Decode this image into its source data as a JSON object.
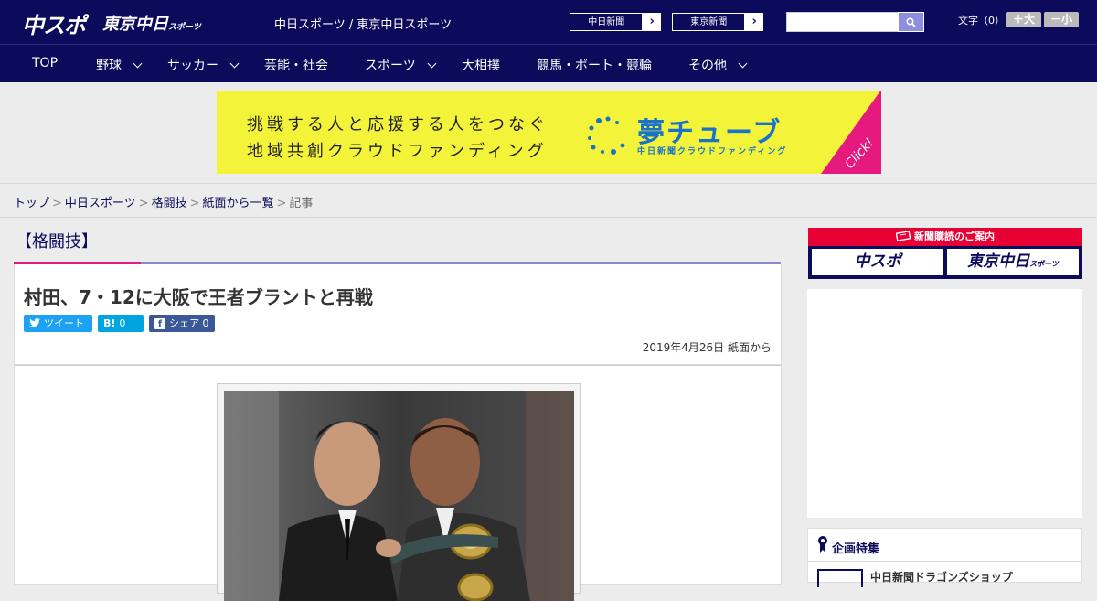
{
  "header": {
    "logo_primary": "中スポ",
    "logo_secondary": "東京中日",
    "logo_secondary_small": "スポーツ",
    "site_title": "中日スポーツ / 東京中日スポーツ",
    "links": [
      {
        "label": "中日新聞",
        "arrow": "›"
      },
      {
        "label": "東京新聞",
        "arrow": "›"
      }
    ],
    "search_placeholder": "",
    "font_size_label": "文字（0）",
    "font_bigger": "＋大",
    "font_smaller": "－小"
  },
  "nav": {
    "items": [
      {
        "label": "TOP",
        "dropdown": false
      },
      {
        "label": "野球",
        "dropdown": true
      },
      {
        "label": "サッカー",
        "dropdown": true
      },
      {
        "label": "芸能・社会",
        "dropdown": false
      },
      {
        "label": "スポーツ",
        "dropdown": true
      },
      {
        "label": "大相撲",
        "dropdown": false
      },
      {
        "label": "競馬・ボート・競輪",
        "dropdown": false
      },
      {
        "label": "その他",
        "dropdown": true
      }
    ]
  },
  "ad": {
    "line1": "挑戦する人と応援する人をつなぐ",
    "line2": "地域共創クラウドファンディング",
    "brand": "夢チューブ",
    "brand_sub": "中日新聞クラウドファンディング",
    "click": "Click!",
    "colors": {
      "bg": "#f3f33a",
      "brand": "#1a73c9",
      "corner": "#e6197f"
    }
  },
  "breadcrumb": {
    "items": [
      "トップ",
      "中日スポーツ",
      "格闘技",
      "紙面から一覧"
    ],
    "current": "記事",
    "separator": ">"
  },
  "article": {
    "category": "【格闘技】",
    "headline": "村田、7・12に大阪で王者ブラントと再戦",
    "share": {
      "tweet": "ツイート",
      "hatena_icon": "B!",
      "hatena_count": "0",
      "facebook_icon": "f",
      "facebook_label": "シェア",
      "facebook_count": "0"
    },
    "date": "2019年4月26日",
    "source": "紙面から"
  },
  "sidebar": {
    "subscription_title": "新聞購読のご案内",
    "subscription_logo1": "中スポ",
    "subscription_logo2": "東京中日",
    "subscription_logo2_small": "スポーツ",
    "feature_title": "企画特集",
    "feature_item": "中日新聞ドラゴンズショップ"
  },
  "colors": {
    "header_bg": "#0c0a5a",
    "accent_pink": "#e6197f",
    "accent_red": "#e60033",
    "twitter": "#1da1f2",
    "hatena": "#00a4de",
    "facebook": "#3b5998"
  }
}
